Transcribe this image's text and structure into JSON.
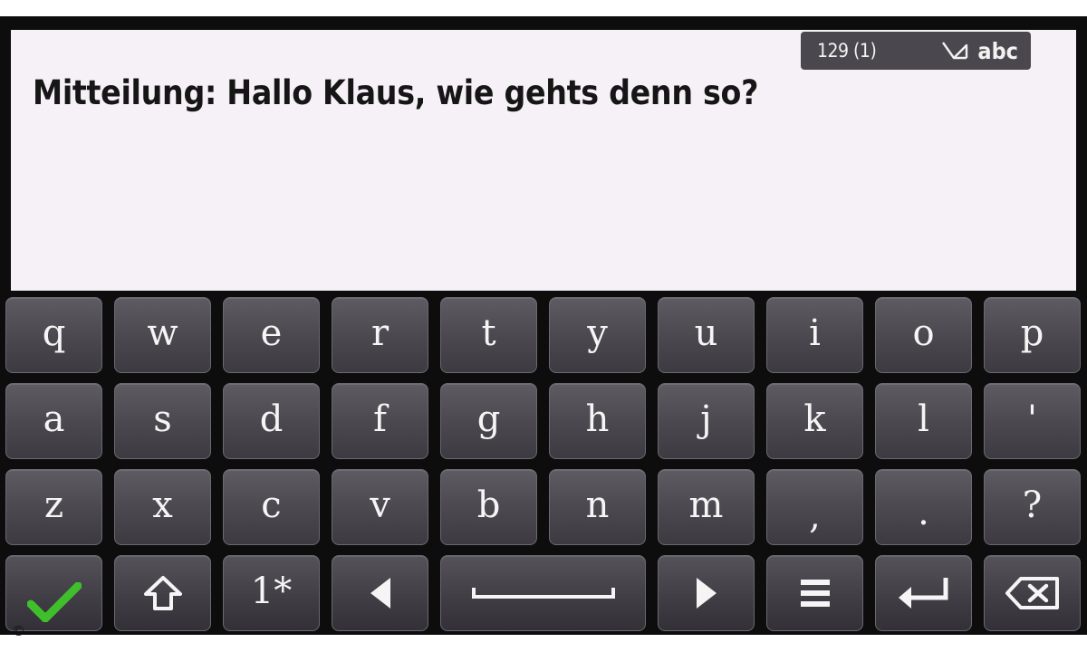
{
  "status_bar": {
    "counter": "129 (1)",
    "mode_label": "abc",
    "mode_icon": "pen-icon"
  },
  "message": {
    "text": "Mitteilung: Hallo Klaus, wie gehts denn so?"
  },
  "keyboard": {
    "row1": [
      "q",
      "w",
      "e",
      "r",
      "t",
      "y",
      "u",
      "i",
      "o",
      "p"
    ],
    "row2": [
      "a",
      "s",
      "d",
      "f",
      "g",
      "h",
      "j",
      "k",
      "l",
      "'"
    ],
    "row3": [
      "z",
      "x",
      "c",
      "v",
      "b",
      "n",
      "m",
      ",",
      ".",
      "?"
    ],
    "function_row": {
      "confirm_icon": "checkmark-icon",
      "shift_icon": "shift-icon",
      "symbols_label": "1*",
      "left_icon": "arrow-left-icon",
      "space_icon": "space-icon",
      "right_icon": "arrow-right-icon",
      "menu_icon": "menu-icon",
      "enter_icon": "enter-icon",
      "backspace_icon": "backspace-icon"
    }
  },
  "footer": {
    "copyright": "©"
  },
  "colors": {
    "key_face": "#4a474f",
    "text_area": "#f6f1f6",
    "confirm_green": "#3fbf2c",
    "status_pill": "#4a474e"
  }
}
